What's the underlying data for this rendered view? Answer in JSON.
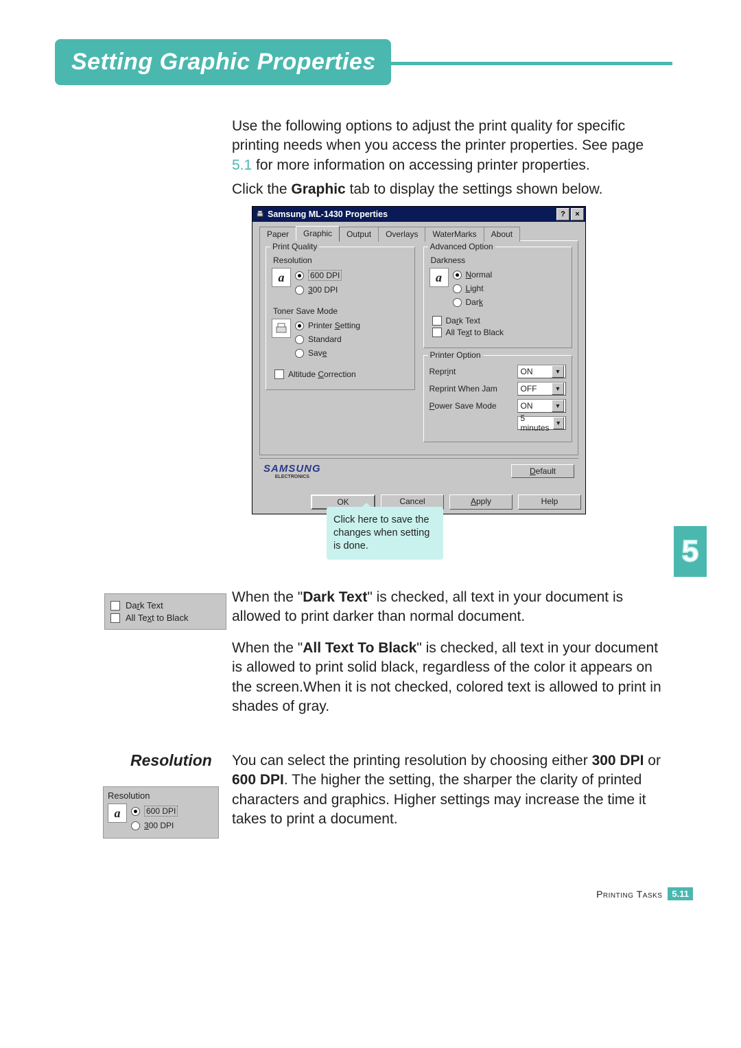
{
  "title": "Setting Graphic Properties",
  "chapter_tab": "5",
  "intro1_a": "Use the following options to adjust the print quality for specific printing needs when you access the printer properties. See page ",
  "intro1_link": "5.1",
  "intro1_b": " for more information on accessing printer properties.",
  "intro2_a": "Click the ",
  "intro2_b": "Graphic",
  "intro2_c": " tab to display the settings shown below.",
  "dialog": {
    "title": "Samsung ML-1430 Properties",
    "help_btn": "?",
    "close_btn": "×",
    "tabs": [
      "Paper",
      "Graphic",
      "Output",
      "Overlays",
      "WaterMarks",
      "About"
    ],
    "active_tab": 1,
    "print_quality": {
      "group": "Print Quality",
      "resolution_label": "Resolution",
      "icon": "a",
      "opt_600": "600 DPI",
      "opt_300": "300 DPI",
      "toner_label": "Toner Save Mode",
      "toner_opt_setting": "Printer Setting",
      "toner_opt_standard": "Standard",
      "toner_opt_save": "Save",
      "altitude": "Altitude Correction"
    },
    "advanced": {
      "group": "Advanced Option",
      "darkness_label": "Darkness",
      "icon": "a",
      "opt_normal": "Normal",
      "opt_light": "Light",
      "opt_dark": "Dark",
      "dark_text": "Dark Text",
      "all_black": "All Text to Black"
    },
    "printer_option": {
      "group": "Printer Option",
      "reprint_label": "Reprint",
      "reprint_val": "ON",
      "reprint_jam_label": "Reprint When Jam",
      "reprint_jam_val": "OFF",
      "power_label": "Power Save Mode",
      "power_val": "ON",
      "power_time_val": "5 minutes"
    },
    "brand": "SAMSUNG",
    "brand_sub": "ELECTRONICS",
    "default_btn": "Default",
    "ok": "OK",
    "cancel": "Cancel",
    "apply": "Apply",
    "help": "Help"
  },
  "callout": "Click here to save the changes when setting is done.",
  "side_checks": {
    "dark_text": "Dark Text",
    "all_black": "All Text to Black"
  },
  "para_dark_a": "When the \"",
  "para_dark_b": "Dark Text",
  "para_dark_c": "\" is checked, all text in your document is allowed to print darker than normal document.",
  "para_black_a": "When the \"",
  "para_black_b": "All Text To Black",
  "para_black_c": "\" is checked, all text in your document is allowed to print solid black, regardless of the color it appears on the screen.When it is not checked, colored text is allowed to print in shades of gray.",
  "resolution_heading": "Resolution",
  "para_res_a": "You can select the printing resolution by choosing either ",
  "para_res_b": "300 DPI",
  "para_res_mid": " or ",
  "para_res_c": "600 DPI",
  "para_res_d": ". The higher the setting, the sharper the clarity of printed characters and graphics. Higher settings may increase the time it takes to print a document.",
  "res_side": {
    "label": "Resolution",
    "icon": "a",
    "opt_600": "600 DPI",
    "opt_300": "300 DPI"
  },
  "footer": {
    "section": "Printing Tasks",
    "page_prefix": "5.",
    "page_num": "11"
  }
}
